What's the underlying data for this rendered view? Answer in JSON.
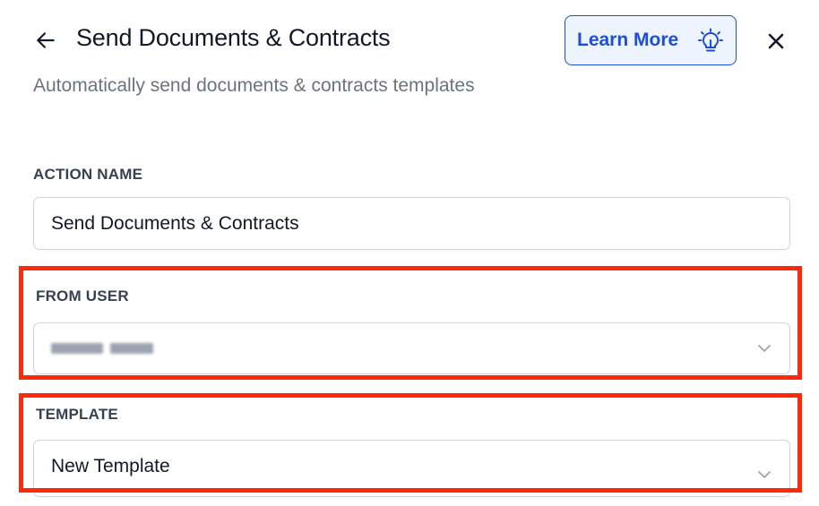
{
  "header": {
    "title": "Send Documents & Contracts",
    "subtitle": "Automatically send documents & contracts templates",
    "learn_more_label": "Learn More",
    "back_icon": "arrow-left-icon",
    "learn_more_icon": "lightbulb-icon",
    "close_icon": "close-icon"
  },
  "form": {
    "action_name": {
      "label": "ACTION NAME",
      "value": "Send Documents & Contracts"
    },
    "from_user": {
      "label": "FROM USER",
      "value": "",
      "value_blurred": true,
      "icon": "chevron-down-icon"
    },
    "template": {
      "label": "TEMPLATE",
      "value": "New Template",
      "icon": "chevron-down-icon"
    }
  },
  "colors": {
    "accent": "#1d4ed8",
    "accent_bg": "#eef4ff",
    "highlight": "#ff2a0a",
    "title": "#111827",
    "muted": "#6b7280"
  }
}
